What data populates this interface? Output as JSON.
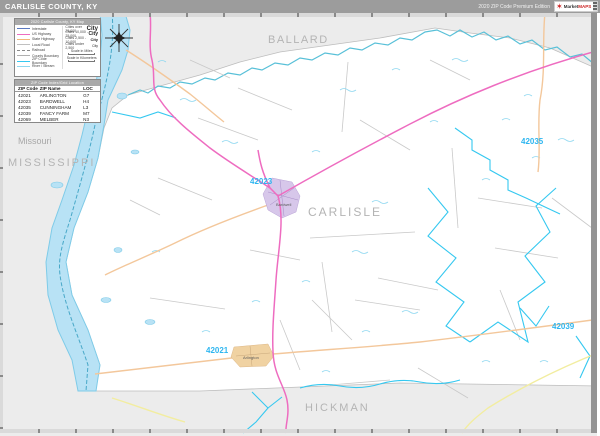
{
  "header": {
    "title": "CARLISLE COUNTY, KY",
    "edition": "2020 ZIP Code Premium Edition",
    "logo_brand_1": "Market",
    "logo_brand_2": "MAPS"
  },
  "legend": {
    "title": "2020 Carlisle County, KY Map",
    "items": [
      {
        "label": "Interstate",
        "color": "#5a78c0"
      },
      {
        "label": "US Highway",
        "color": "#ee6cc0"
      },
      {
        "label": "State Highway",
        "color": "#f3b87a"
      },
      {
        "label": "Local Road",
        "color": "#c0c0c0"
      },
      {
        "label": "Railroad",
        "color": "#8a8a8a"
      },
      {
        "label": "County Boundary",
        "color": "#b0b0b0"
      },
      {
        "label": "ZIP Code Boundary",
        "color": "#35c8f0"
      },
      {
        "label": "River / Stream",
        "color": "#8fd8f0"
      }
    ],
    "city_sizes": [
      {
        "range": "Cities over 25,000",
        "sample": "City"
      },
      {
        "range": "Cities 10,000 - 25,000",
        "sample": "City"
      },
      {
        "range": "Cities 2,500 - 10,000",
        "sample": "City"
      },
      {
        "range": "Cities under 2,500",
        "sample": "City"
      }
    ],
    "scale_miles": "Scale in Miles",
    "scale_km": "Scale in Kilometers"
  },
  "zip_table": {
    "title": "ZIP Code Index/Grid Location",
    "columns": [
      "ZIP Code",
      "ZIP Name",
      "LOC"
    ],
    "rows": [
      [
        "42021",
        "ARLINGTON",
        "G7"
      ],
      [
        "42023",
        "BARDWELL",
        "H4"
      ],
      [
        "42035",
        "CUNNINGHAM",
        "L3"
      ],
      [
        "42039",
        "FANCY FARM",
        "M7"
      ],
      [
        "42069",
        "MELBER",
        "N3"
      ]
    ]
  },
  "map": {
    "labels": {
      "ballard": "BALLARD",
      "carlisle": "CARLISLE",
      "hickman": "HICKMAN",
      "missouri": "Missouri",
      "mississippi": "MISSISSIPPI"
    },
    "zip_labels": {
      "z42023": "42023",
      "z42021": "42021",
      "z42035": "42035",
      "z42039": "42039"
    },
    "city_labels": {
      "bardwell": "Bardwell",
      "arlington": "Arlington"
    },
    "colors": {
      "outside_county": "#ececec",
      "county_fill": "#ffffff",
      "water": "#b8e2f5",
      "water_line": "#58c0d8",
      "zip_boundary": "#35c8f0",
      "us_highway": "#ee6cc0",
      "state_highway": "#f3c79b",
      "minor_highway": "#f2eda0",
      "zip_label_text": "#2eb6f0",
      "region_label_text": "#b4b4b4"
    }
  }
}
